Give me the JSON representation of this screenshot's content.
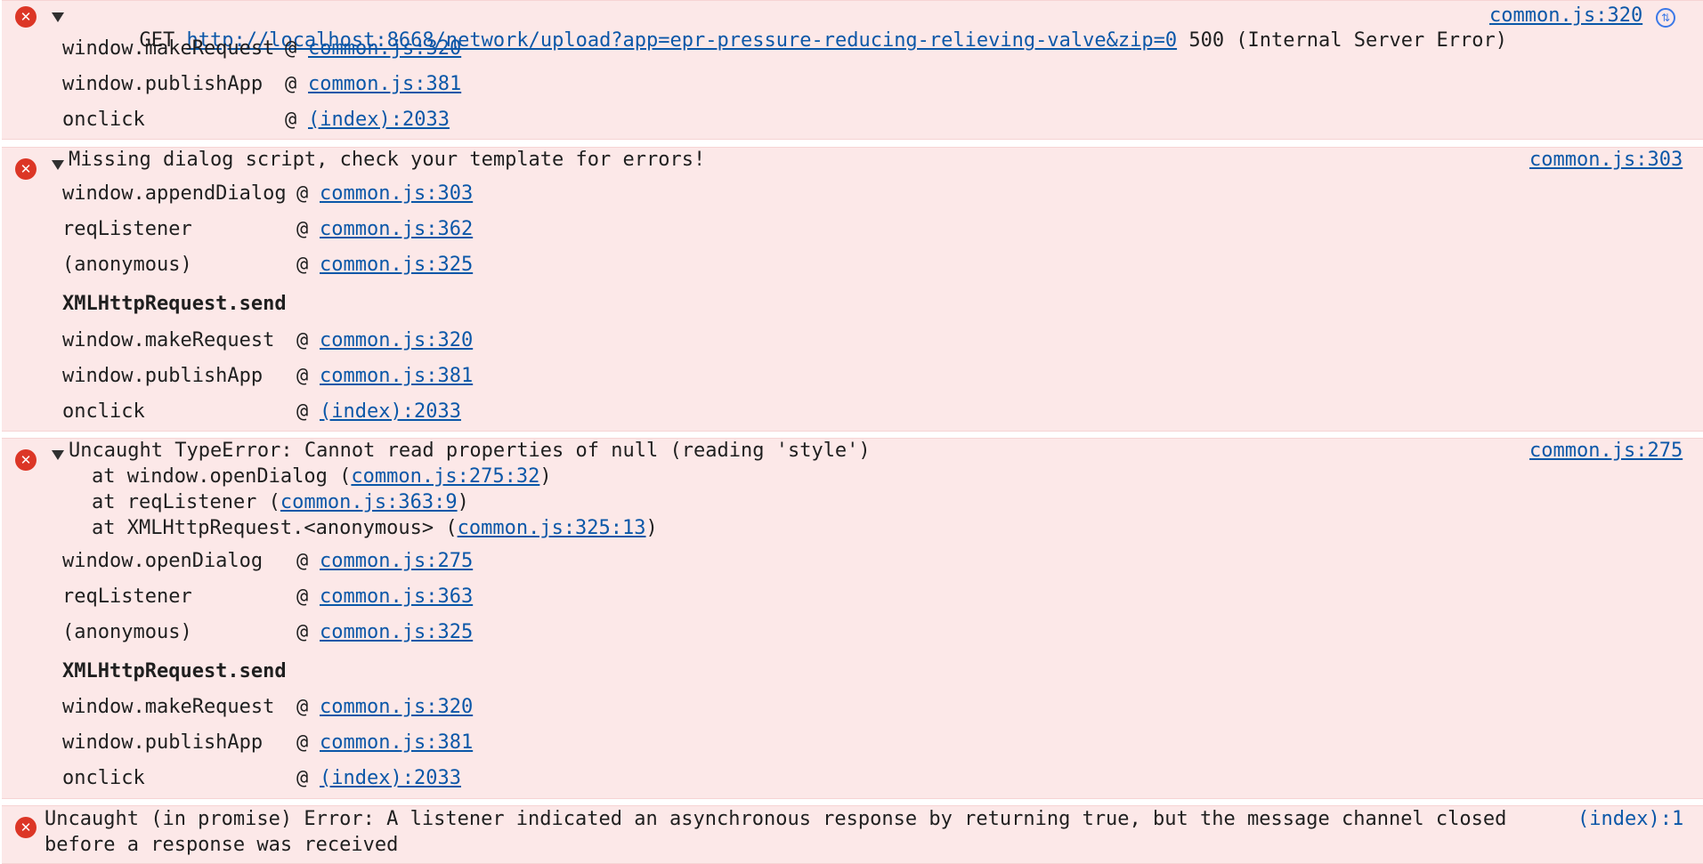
{
  "icons": {
    "error": "error-icon",
    "expand": "triangle-down-icon",
    "network": "network-request-icon"
  },
  "colors": {
    "error_bg": "#fce8e8",
    "link": "#0b57a8",
    "error_icon": "#dc3626"
  },
  "messages": [
    {
      "method": "GET",
      "url": "http://localhost:8668/network/upload?app=epr-pressure-reducing-relieving-valve&zip=0",
      "status": "500 (Internal Server Error)",
      "source": "common.js:320",
      "stack": [
        {
          "fn": "window.makeRequest",
          "at": "@",
          "link": "common.js:320"
        },
        {
          "fn": "window.publishApp",
          "at": "@",
          "link": "common.js:381"
        },
        {
          "fn": "onclick",
          "at": "@",
          "link": "(index):2033"
        }
      ]
    },
    {
      "text": "Missing dialog script, check your template for errors!",
      "source": "common.js:303",
      "stack": [
        {
          "fn": "window.appendDialog",
          "at": "@",
          "link": "common.js:303"
        },
        {
          "fn": "reqListener",
          "at": "@",
          "link": "common.js:362"
        },
        {
          "fn": "(anonymous)",
          "at": "@",
          "link": "common.js:325"
        }
      ],
      "async_label": "XMLHttpRequest.send",
      "stack2": [
        {
          "fn": "window.makeRequest",
          "at": "@",
          "link": "common.js:320"
        },
        {
          "fn": "window.publishApp",
          "at": "@",
          "link": "common.js:381"
        },
        {
          "fn": "onclick",
          "at": "@",
          "link": "(index):2033"
        }
      ]
    },
    {
      "text": "Uncaught TypeError: Cannot read properties of null (reading 'style')",
      "source": "common.js:275",
      "trace": [
        {
          "pre": "at window.openDialog (",
          "link": "common.js:275:32",
          "post": ")"
        },
        {
          "pre": "at reqListener (",
          "link": "common.js:363:9",
          "post": ")"
        },
        {
          "pre": "at XMLHttpRequest.<anonymous> (",
          "link": "common.js:325:13",
          "post": ")"
        }
      ],
      "stack": [
        {
          "fn": "window.openDialog",
          "at": "@",
          "link": "common.js:275"
        },
        {
          "fn": "reqListener",
          "at": "@",
          "link": "common.js:363"
        },
        {
          "fn": "(anonymous)",
          "at": "@",
          "link": "common.js:325"
        }
      ],
      "async_label": "XMLHttpRequest.send",
      "stack2": [
        {
          "fn": "window.makeRequest",
          "at": "@",
          "link": "common.js:320"
        },
        {
          "fn": "window.publishApp",
          "at": "@",
          "link": "common.js:381"
        },
        {
          "fn": "onclick",
          "at": "@",
          "link": "(index):2033"
        }
      ]
    },
    {
      "text_line1": "Uncaught (in promise) Error: A listener indicated an asynchronous response by returning true, but the message channel closed",
      "text_line2": "before a response was received",
      "source": "(index):1"
    }
  ]
}
